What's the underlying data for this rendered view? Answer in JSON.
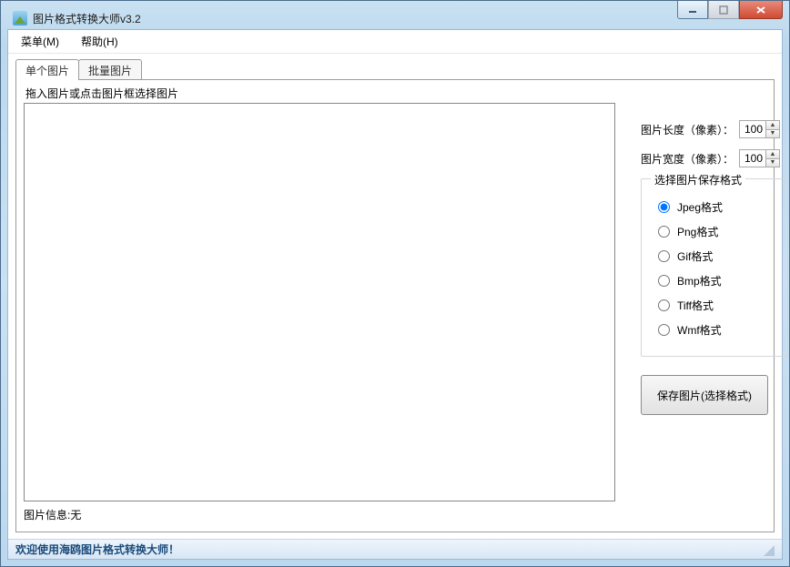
{
  "window": {
    "title": "图片格式转换大师v3.2"
  },
  "menu": {
    "items": [
      "菜单(M)",
      "帮助(H)"
    ]
  },
  "tabs": {
    "items": [
      "单个图片",
      "批量图片"
    ],
    "active": 0
  },
  "drop": {
    "hint": "拖入图片或点击图片框选择图片"
  },
  "dims": {
    "length_label": "图片长度（像素）：",
    "length_value": "100",
    "width_label": "图片宽度（像素）：",
    "width_value": "100"
  },
  "formats": {
    "legend": "选择图片保存格式",
    "options": [
      "Jpeg格式",
      "Png格式",
      "Gif格式",
      "Bmp格式",
      "Tiff格式",
      "Wmf格式"
    ],
    "selected": 0
  },
  "save_button": "保存图片(选择格式)",
  "info": {
    "label": "图片信息:",
    "value": "无"
  },
  "status": "欢迎使用海鸥图片格式转换大师！"
}
